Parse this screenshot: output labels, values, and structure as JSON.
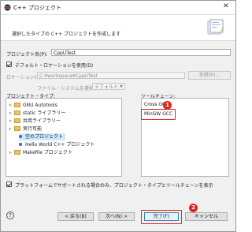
{
  "window": {
    "title": "C++ プロジェクト",
    "close_glyph": "✕"
  },
  "header": {
    "description": "選択したタイプの C++ プロジェクトを作成します"
  },
  "project_name": {
    "label": "プロジェクト名(P):",
    "value": "CppUTest"
  },
  "default_location": {
    "label": "デフォルト・ロケーションを使用(D)",
    "checked": true
  },
  "location": {
    "label": "ロケーション(L):",
    "value": "C:¥workspace¥CppUTest",
    "browse_label": "参照(R)..."
  },
  "filesystem": {
    "label": "ファイル・システムを選択(Y):",
    "value": "デフォルト"
  },
  "project_type": {
    "label": "プロジェクト・タイプ:",
    "items": [
      {
        "label": "GNU Autotools",
        "kind": "folder",
        "arrow": ">"
      },
      {
        "label": "static ライブラリー",
        "kind": "folder",
        "arrow": ">"
      },
      {
        "label": "共用ライブラリー",
        "kind": "folder",
        "arrow": ">"
      },
      {
        "label": "実行可能",
        "kind": "folder",
        "arrow": "v"
      },
      {
        "label": "空のプロジェクト",
        "kind": "bullet",
        "arrow": ""
      },
      {
        "label": "Hello World C++ プロジェクト",
        "kind": "bullet",
        "arrow": ""
      },
      {
        "label": "Makefile プロジェクト",
        "kind": "folder",
        "arrow": ">"
      }
    ]
  },
  "toolchain": {
    "label": "ツールチェーン:",
    "items": [
      {
        "label": "Cross GCC"
      },
      {
        "label": "MinGW GCC"
      }
    ]
  },
  "platform_filter": {
    "label": "プラットフォームでサポートされる場合のみ、プロジェクト・タイプとツールチェーンを表示",
    "checked": true
  },
  "buttons": {
    "help": "?",
    "back": "< 戻る(B)",
    "next": "次へ(N) >",
    "finish": "完了(F)",
    "cancel": "キャンセル"
  },
  "annotations": {
    "one": "1",
    "two": "2"
  },
  "colors": {
    "highlight_red": "#e0261c",
    "selection_bg": "#cce8ff"
  }
}
